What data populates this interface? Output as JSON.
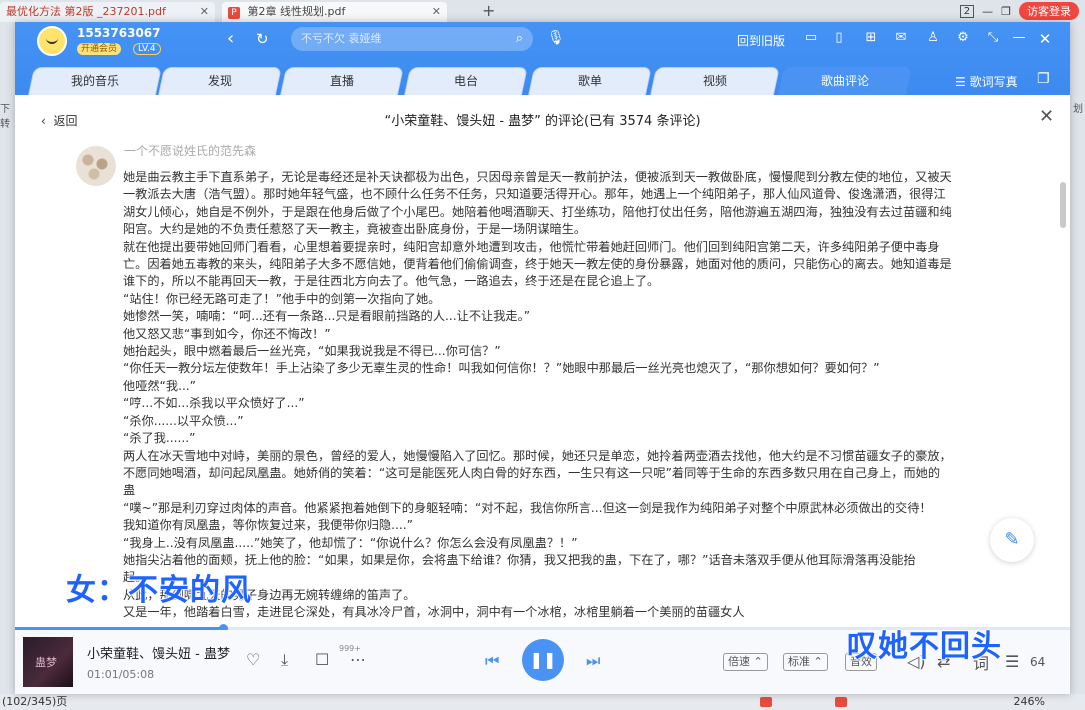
{
  "browser": {
    "tab1_title": "最优化方法 第2版 _237201.pdf",
    "tab2_title": "第2章 线性规划.pdf",
    "tab_count": "2",
    "login_label": "访客登录",
    "left_side_text": "下转",
    "right_side_text": "划",
    "page_indicator": "(102/345)页",
    "zoom_level": "246%"
  },
  "app": {
    "user": {
      "name": "1553763067",
      "vip_label": "开通会员",
      "level": "LV.4"
    },
    "search": {
      "placeholder": "不亏不欠 袁娅维"
    },
    "old_version_label": "回到旧版",
    "tabs": [
      {
        "label": "我的音乐"
      },
      {
        "label": "发现"
      },
      {
        "label": "直播"
      },
      {
        "label": "电台"
      },
      {
        "label": "歌单"
      },
      {
        "label": "视频"
      },
      {
        "label": "歌曲评论"
      }
    ],
    "lyric_label": "歌词写真",
    "panel": {
      "back_label": "返回",
      "title": "“小荣童鞋、馒头妞 - 蛊梦” 的评论(已有 3574 条评论)"
    },
    "comment": {
      "author": "一个不愿说姓氏的范先森",
      "lines": [
        "她是曲云教主手下直系弟子，无论是毒经还是补天诀都极为出色，只因母亲曾是天一教前护法，便被派到天一教做卧底，慢慢爬到分教左使的地位，又被天",
        "一教派去大唐（浩气盟）。那时她年轻气盛，也不顾什么任务不任务，只知道要活得开心。那年，她遇上一个纯阳弟子，那人仙风道骨、俊逸潇洒，很得江",
        "湖女儿倾心，她自是不例外，于是跟在他身后做了个小尾巴。她陪着他喝酒聊天、打坐练功，陪他打仗出任务，陪他游遍五湖四海，独独没有去过苗疆和纯",
        "阳宫。大约是她的不负责任惹怒了天一教主，竟被查出卧底身份，于是一场阴谋暗生。",
        "就在他提出要带她回师门看看，心里想着要提亲时，纯阳宫却意外地遭到攻击，他慌忙带着她赶回师门。他们回到纯阳宫第二天，许多纯阳弟子便中毒身",
        "亡。因着她五毒教的来头，纯阳弟子大多不愿信她，便背着他们偷偷调查，终于她天一教左使的身份暴露，她面对他的质问，只能伤心的离去。她知道毒是",
        "谁下的，所以不能再回天一教，于是往西北方向去了。他气急，一路追去，终于还是在昆仑追上了。",
        "“站住！你已经无路可走了！”他手中的剑第一次指向了她。",
        "她惨然一笑，喃喃：“呵...还有一条路...只是看眼前挡路的人...让不让我走。”",
        "他又怒又悲“事到如今，你还不悔改！”",
        "她抬起头，眼中燃着最后一丝光亮，“如果我说我是不得已...你可信？”",
        "“你任天一教分坛左使数年！手上沾染了多少无辜生灵的性命！叫我如何信你！？”她眼中那最后一丝光亮也熄灭了，“那你想如何？要如何？”",
        "他哑然“我...”",
        "“哼...不如...杀我以平众愤好了...”",
        "“杀你......以平众愤...”",
        "“杀了我......”",
        "两人在冰天雪地中对峙，美丽的景色，曾经的爱人，她慢慢陷入了回忆。那时候，她还只是单恋，她拎着两壶酒去找他，他大约是不习惯苗疆女子的豪放，",
        "不愿同她喝酒，却问起凤凰蛊。她娇俏的笑着：“这可是能医死人肉白骨的好东西，一生只有这一只呢”着同等于生命的东西多数只用在自己身上，而她的",
        "蛊",
        "“噗~”那是利刃穿过肉体的声音。他紧紧抱着她倒下的身躯轻喃：“对不起，我信你所言...但这一剑是我作为纯阳弟子对整个中原武林必须做出的交待！",
        "我知道你有凤凰蛊，等你恢复过来，我便带你归隐....”",
        "“我身上..没有凤凰蛊.....”她笑了，他却慌了：“你说什么？你怎么会没有凤凰蛊？！”",
        "她指尖沾着他的面颊，抚上他的脸：“如果，如果是你，会将蛊下给谁？你猜，我又把我的蛊，下在了，哪？”话音未落双手便从他耳际滑落再没能抬",
        "起。",
        "从此，那剑啸九天的男子身边再无婉转缠绵的笛声了。",
        "又是一年，他踏着白雪，走进昆仑深处，有具冰冷尸首，冰洞中，洞中有一个冰棺，冰棺里躺着一个美丽的苗疆女人"
      ]
    },
    "player": {
      "song_title": "小荣童鞋、馒头妞 - 蛊梦",
      "time": "01:01/05:08",
      "progress": 0.198,
      "comment_count": "999+",
      "speed_label": "倍速",
      "quality_label": "标准",
      "sound_label": "音效",
      "lyric_label": "词",
      "playlist_count": "64"
    }
  },
  "subtitles": {
    "left": "女：不安的风",
    "right": "叹她不回头"
  }
}
